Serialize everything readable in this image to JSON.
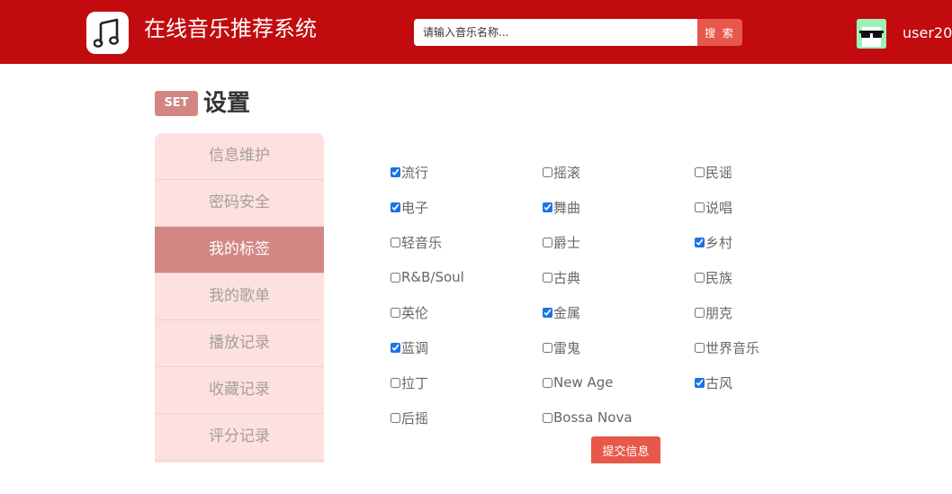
{
  "header": {
    "site_title": "在线音乐推荐系统",
    "search": {
      "placeholder": "请输入音乐名称...",
      "button_label": "搜 索"
    },
    "username": "user20"
  },
  "page": {
    "badge": "SET",
    "title": "设置"
  },
  "sidebar": {
    "items": [
      {
        "label": "信息维护",
        "active": false
      },
      {
        "label": "密码安全",
        "active": false
      },
      {
        "label": "我的标签",
        "active": true
      },
      {
        "label": "我的歌单",
        "active": false
      },
      {
        "label": "播放记录",
        "active": false
      },
      {
        "label": "收藏记录",
        "active": false
      },
      {
        "label": "评分记录",
        "active": false
      }
    ]
  },
  "tags": [
    {
      "label": "流行",
      "checked": true
    },
    {
      "label": "摇滚",
      "checked": false
    },
    {
      "label": "民谣",
      "checked": false
    },
    {
      "label": "电子",
      "checked": true
    },
    {
      "label": "舞曲",
      "checked": true
    },
    {
      "label": "说唱",
      "checked": false
    },
    {
      "label": "轻音乐",
      "checked": false
    },
    {
      "label": "爵士",
      "checked": false
    },
    {
      "label": "乡村",
      "checked": true
    },
    {
      "label": "R&B/Soul",
      "checked": false
    },
    {
      "label": "古典",
      "checked": false
    },
    {
      "label": "民族",
      "checked": false
    },
    {
      "label": "英伦",
      "checked": false
    },
    {
      "label": "金属",
      "checked": true
    },
    {
      "label": "朋克",
      "checked": false
    },
    {
      "label": "蓝调",
      "checked": true
    },
    {
      "label": "雷鬼",
      "checked": false
    },
    {
      "label": "世界音乐",
      "checked": false
    },
    {
      "label": "拉丁",
      "checked": false
    },
    {
      "label": "New Age",
      "checked": false
    },
    {
      "label": "古风",
      "checked": true
    },
    {
      "label": "后摇",
      "checked": false
    },
    {
      "label": "Bossa Nova",
      "checked": false
    }
  ],
  "submit_label": "提交信息",
  "colors": {
    "header_bg": "#c10b0e",
    "accent": "#e8584a",
    "sidebar_bg": "#fde1e0",
    "sidebar_active": "#d28784"
  }
}
